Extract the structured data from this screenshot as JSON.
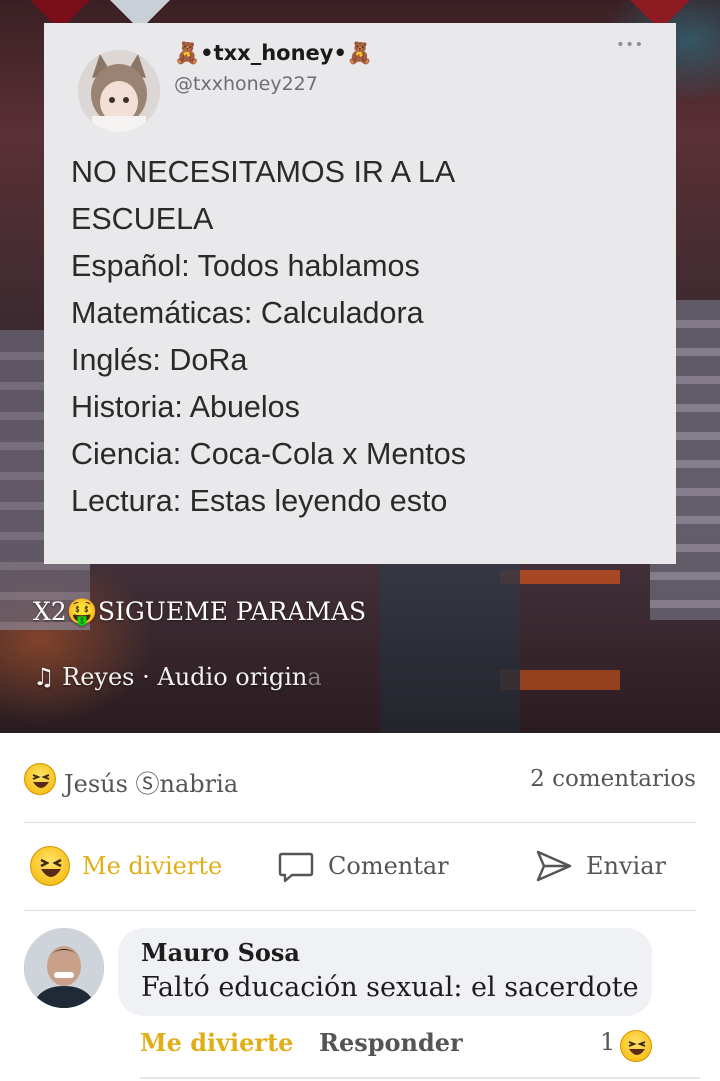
{
  "video": {
    "tweet": {
      "display_name": "🧸•txx_honey•🧸",
      "handle": "@txxhoney227",
      "lines": [
        "NO NECESITAMOS IR A LA",
        "ESCUELA",
        "Español: Todos hablamos",
        "Matemáticas: Calculadora",
        "Inglés: DoRa",
        "Historia: Abuelos",
        "Ciencia: Coca-Cola x Mentos",
        "Lectura: Estas leyendo esto"
      ]
    },
    "caption": "X2🤑SIGUEME PARAMAS",
    "audio_prefix": "♫  Reyes · Audio origin",
    "audio_fade": "a"
  },
  "reactions": {
    "reactors": "Jesús Ⓢnabria",
    "comments_count": "2 comentarios"
  },
  "actions": {
    "like_label": "Me divierte",
    "comment_label": "Comentar",
    "send_label": "Enviar"
  },
  "comment": {
    "author": "Mauro Sosa",
    "text": "Faltó educación sexual: el sacerdote",
    "like_label": "Me divierte",
    "reply_label": "Responder",
    "reaction_count": "1"
  },
  "colors": {
    "accent_reaction": "#e0ae16",
    "tweet_bg": "#e9e8eb",
    "bubble_bg": "#f0f1f4"
  }
}
